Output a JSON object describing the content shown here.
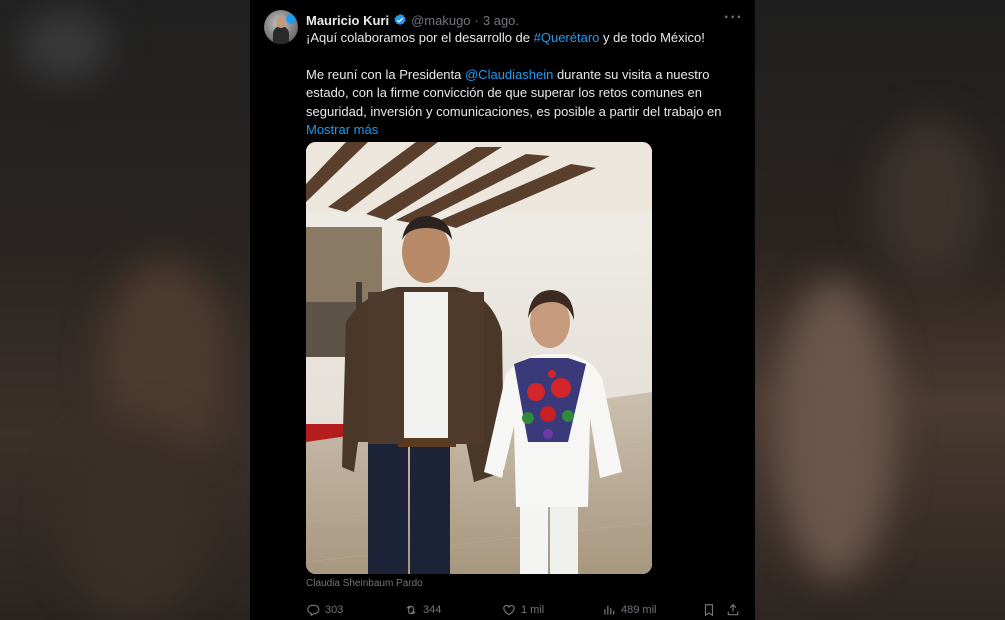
{
  "tweet": {
    "author_name": "Mauricio Kuri",
    "handle": "@makugo",
    "separator": "·",
    "date": "3 ago.",
    "line1_pre": "¡Aquí colaboramos por el desarrollo de ",
    "hashtag": "#Querétaro",
    "line1_post": " y de todo México!",
    "para2_pre": "Me reuní con la Presidenta ",
    "mention": "@Claudiashein",
    "para2_post": " durante su visita a nuestro estado, con la firme convicción de que superar los retos comunes en seguridad, inversión y comunicaciones, es posible a partir del trabajo en",
    "show_more": "Mostrar más",
    "image_caption": "Claudia Sheinbaum Pardo"
  },
  "actions": {
    "replies": "303",
    "retweets": "344",
    "likes": "1 mil",
    "views": "489 mil"
  },
  "colors": {
    "background": "#000000",
    "text": "#e7e9ea",
    "secondary": "#71767b",
    "link": "#1d9bf0"
  },
  "icons": [
    "verified-badge-icon",
    "more-icon",
    "reply-icon",
    "retweet-icon",
    "like-icon",
    "views-icon",
    "bookmark-icon",
    "share-icon"
  ]
}
